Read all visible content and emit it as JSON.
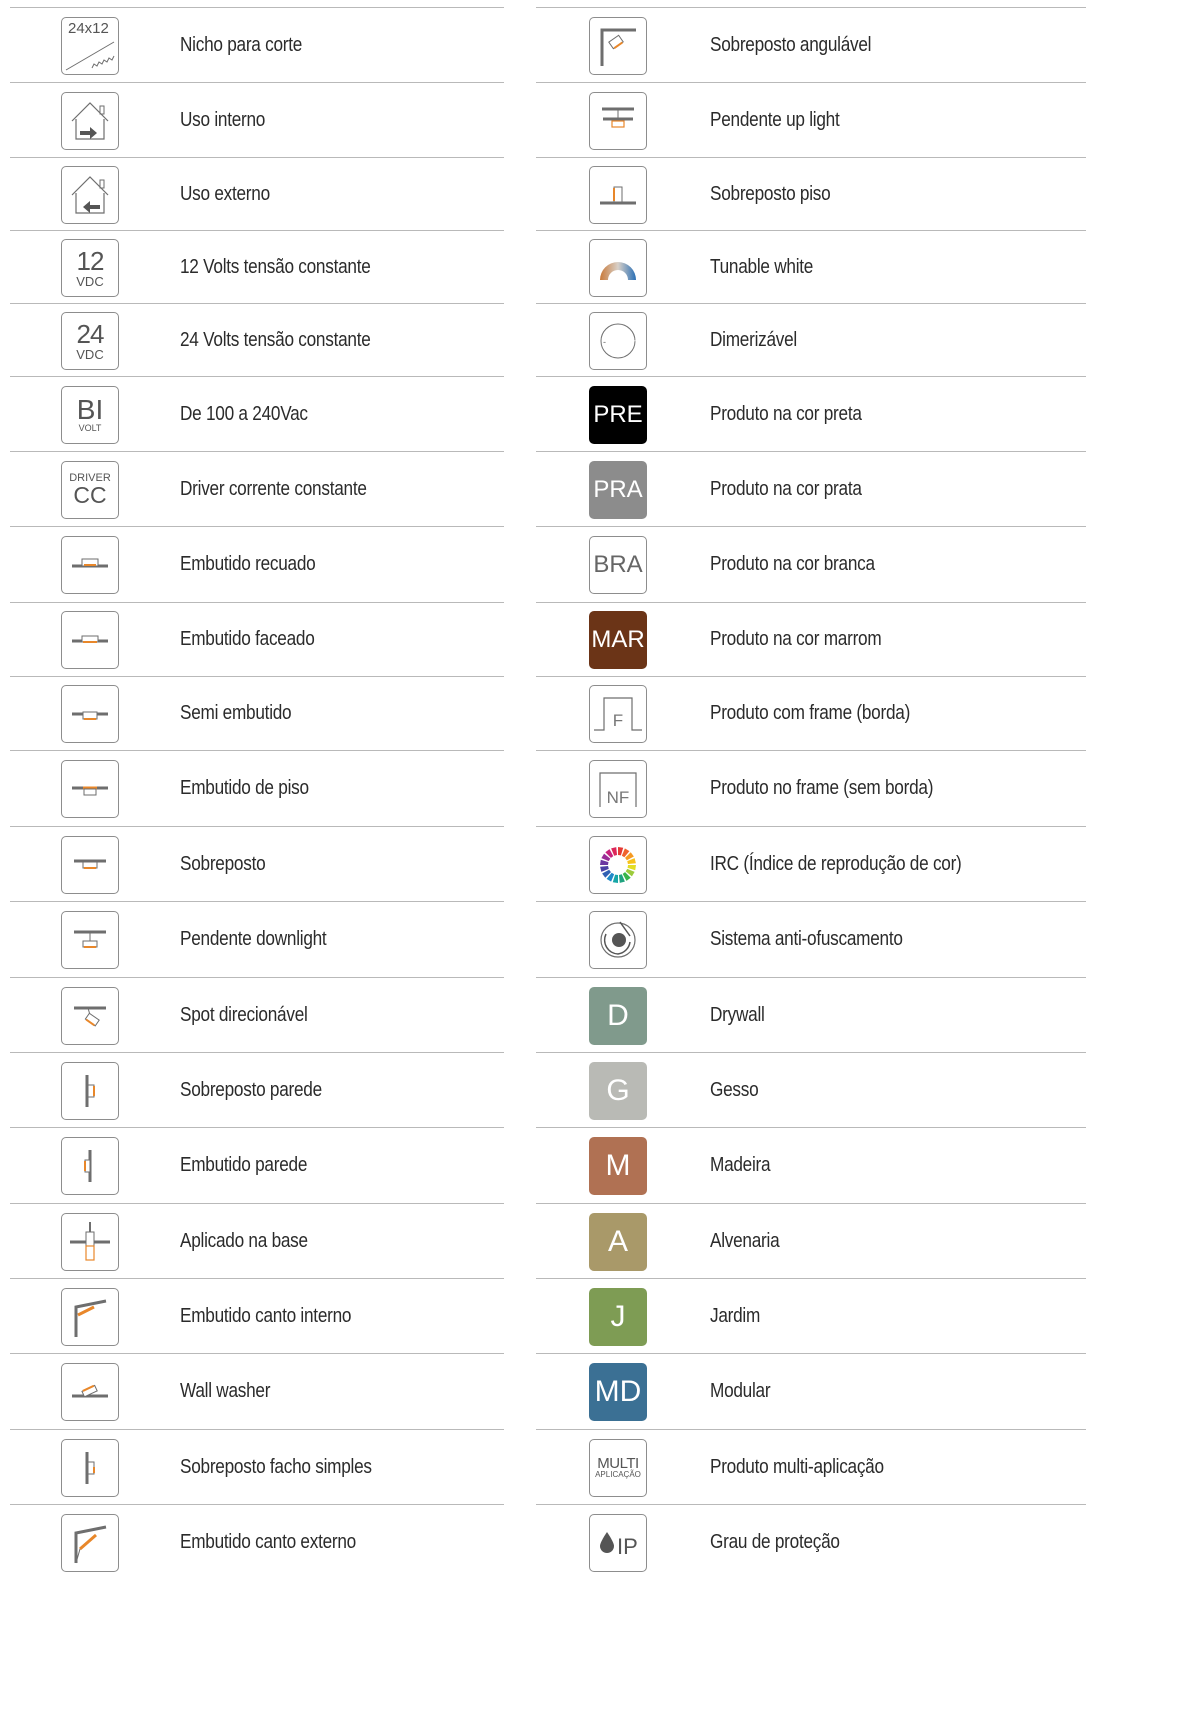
{
  "left": [
    {
      "icon": "saw-cut-icon",
      "label": "Nicho para corte",
      "code": "24x12"
    },
    {
      "icon": "house-indoor-icon",
      "label": "Uso interno"
    },
    {
      "icon": "house-outdoor-icon",
      "label": "Uso externo"
    },
    {
      "icon": "12vdc-icon",
      "label": "12 Volts tensão constante",
      "num": "12",
      "unit": "VDC"
    },
    {
      "icon": "24vdc-icon",
      "label": "24 Volts tensão constante",
      "num": "24",
      "unit": "VDC"
    },
    {
      "icon": "bivolt-icon",
      "label": "De 100 a 240Vac",
      "num": "BI",
      "unit": "VOLT"
    },
    {
      "icon": "driver-cc-icon",
      "label": "Driver corrente constante",
      "num": "CC",
      "unit": "DRIVER"
    },
    {
      "icon": "recessed-recuado-icon",
      "label": "Embutido recuado"
    },
    {
      "icon": "recessed-flush-icon",
      "label": "Embutido faceado"
    },
    {
      "icon": "semi-recessed-icon",
      "label": "Semi embutido"
    },
    {
      "icon": "floor-recessed-icon",
      "label": "Embutido de piso"
    },
    {
      "icon": "surface-mount-icon",
      "label": "Sobreposto"
    },
    {
      "icon": "pendant-downlight-icon",
      "label": "Pendente downlight"
    },
    {
      "icon": "adjustable-spot-icon",
      "label": "Spot direcionável"
    },
    {
      "icon": "wall-surface-icon",
      "label": "Sobreposto parede"
    },
    {
      "icon": "wall-recessed-icon",
      "label": "Embutido parede"
    },
    {
      "icon": "base-mount-icon",
      "label": "Aplicado na base"
    },
    {
      "icon": "inner-corner-icon",
      "label": "Embutido canto interno"
    },
    {
      "icon": "wall-washer-icon",
      "label": "Wall washer"
    },
    {
      "icon": "single-beam-icon",
      "label": "Sobreposto facho simples"
    },
    {
      "icon": "outer-corner-icon",
      "label": "Embutido canto externo"
    }
  ],
  "right": [
    {
      "icon": "angled-surface-icon",
      "label": "Sobreposto angulável"
    },
    {
      "icon": "pendant-uplight-icon",
      "label": "Pendente up light"
    },
    {
      "icon": "floor-surface-icon",
      "label": "Sobreposto piso"
    },
    {
      "icon": "tunable-white-icon",
      "label": "Tunable white"
    },
    {
      "icon": "dimmer-icon",
      "label": "Dimerizável"
    },
    {
      "icon": "color-black-icon",
      "label": "Produto na cor preta",
      "code": "PRE",
      "bg": "#000000",
      "fg": "#ffffff"
    },
    {
      "icon": "color-silver-icon",
      "label": "Produto na cor prata",
      "code": "PRA",
      "bg": "#8c8c8c",
      "fg": "#ffffff"
    },
    {
      "icon": "color-white-icon",
      "label": "Produto na cor branca",
      "code": "BRA",
      "bg": "#ffffff",
      "fg": "#666666"
    },
    {
      "icon": "color-brown-icon",
      "label": "Produto na cor marrom",
      "code": "MAR",
      "bg": "#6b3417",
      "fg": "#ffffff"
    },
    {
      "icon": "frame-icon",
      "label": "Produto com frame (borda)",
      "code": "F"
    },
    {
      "icon": "no-frame-icon",
      "label": "Produto no frame (sem borda)",
      "code": "NF"
    },
    {
      "icon": "color-wheel-icon",
      "label": "IRC (Índice de reprodução de cor)"
    },
    {
      "icon": "anti-glare-icon",
      "label": "Sistema anti-ofuscamento"
    },
    {
      "icon": "drywall-icon",
      "label": "Drywall",
      "code": "D",
      "bg": "#809a8c",
      "fg": "#ffffff"
    },
    {
      "icon": "gypsum-icon",
      "label": "Gesso",
      "code": "G",
      "bg": "#b9bab5",
      "fg": "#ffffff"
    },
    {
      "icon": "wood-icon",
      "label": "Madeira",
      "code": "M",
      "bg": "#b07153",
      "fg": "#ffffff"
    },
    {
      "icon": "masonry-icon",
      "label": "Alvenaria",
      "code": "A",
      "bg": "#a99969",
      "fg": "#ffffff"
    },
    {
      "icon": "garden-icon",
      "label": "Jardim",
      "code": "J",
      "bg": "#7e9c54",
      "fg": "#ffffff"
    },
    {
      "icon": "modular-icon",
      "label": "Modular",
      "code": "MD",
      "bg": "#3b7094",
      "fg": "#ffffff"
    },
    {
      "icon": "multi-application-icon",
      "label": "Produto multi-aplicação",
      "code": "MULTI",
      "sub": "APLICAÇÃO"
    },
    {
      "icon": "ip-rating-icon",
      "label": "Grau de proteção",
      "code": "IP"
    }
  ]
}
